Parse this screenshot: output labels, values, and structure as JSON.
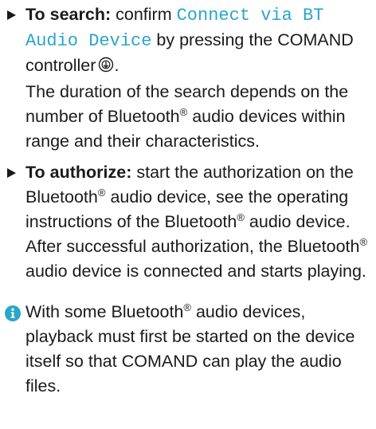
{
  "steps": [
    {
      "label": "To search:",
      "intro": "confirm",
      "mono_text": "Connect via BT Audio Device",
      "text_after_mono": "by pressing the COMAND controller",
      "end_punct": ".",
      "icon": "controller-press-icon",
      "followup": {
        "before_reg": "The duration of the search depends on the number of Bluetooth",
        "reg": "®",
        "after_reg": "audio devices within range and their characteristics."
      }
    },
    {
      "label": "To authorize:",
      "line1": "start the authorization on the Bluetooth",
      "reg": "®",
      "line2": "audio device, see the operating instructions of the Bluetooth",
      "line3": "audio device.",
      "followup": {
        "before_reg": "After successful authorization, the Bluetooth",
        "reg": "®",
        "after_reg": "audio device is connected and starts playing."
      }
    }
  ],
  "note": {
    "icon": "info-icon",
    "icon_color": "#2aa6c9",
    "before_reg": "With some Bluetooth",
    "reg": "®",
    "after_reg": "audio devices, playback must first be started on the device itself so that COMAND can play the audio files."
  },
  "colors": {
    "text": "#1a1a1a",
    "accent": "#2aa6c9"
  }
}
